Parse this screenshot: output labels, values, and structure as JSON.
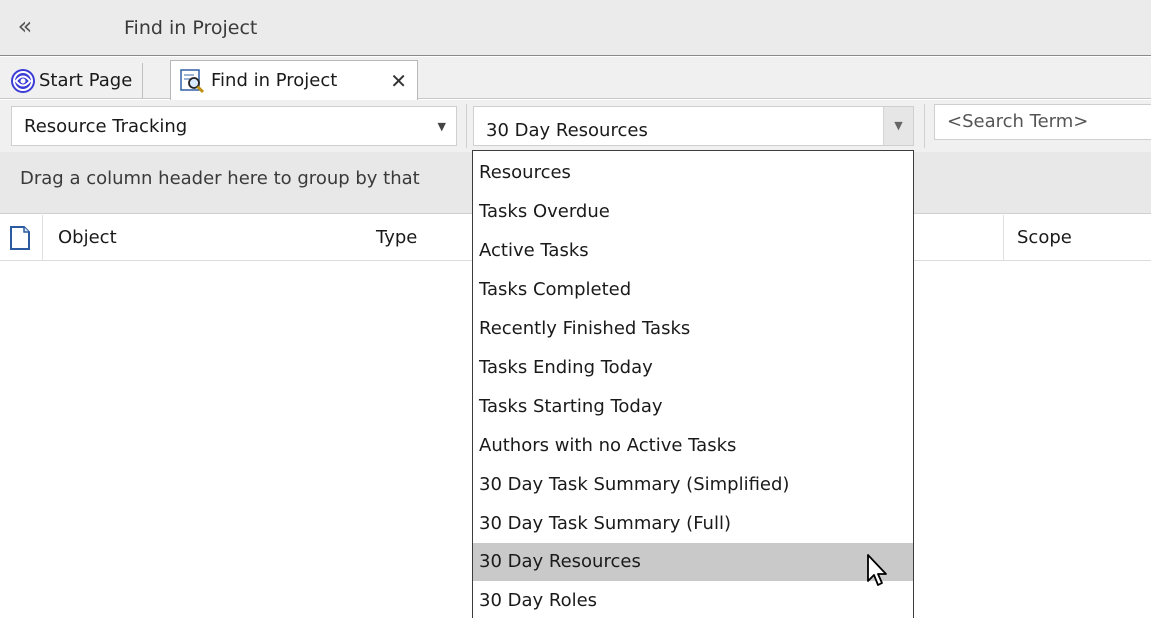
{
  "window": {
    "title": "Find in Project",
    "collapse_icon": "double-chevron-left-icon"
  },
  "tabs": [
    {
      "label": "Start Page",
      "icon": "start-page-icon",
      "active": false
    },
    {
      "label": "Find in Project",
      "icon": "find-in-project-icon",
      "active": true,
      "close_label": "✕"
    }
  ],
  "toolbar": {
    "category": {
      "value": "Resource Tracking"
    },
    "search": {
      "value": "30 Day Resources"
    },
    "search_term": {
      "placeholder": "<Search Term>"
    }
  },
  "group_hint": "Drag a column header here to group by that",
  "columns": [
    "Object",
    "Type",
    "Scope"
  ],
  "dropdown": {
    "options": [
      "Resources",
      "Tasks Overdue",
      "Active Tasks",
      "Tasks Completed",
      "Recently Finished Tasks",
      "Tasks Ending Today",
      "Tasks Starting Today",
      "Authors with no Active Tasks",
      "30 Day Task Summary (Simplified)",
      "30 Day Task Summary (Full)",
      "30 Day Resources",
      "30 Day Roles"
    ],
    "selected_index": 10
  },
  "colors": {
    "selected_row": "#c9c9c9",
    "start_icon": "#3b3bd6"
  }
}
